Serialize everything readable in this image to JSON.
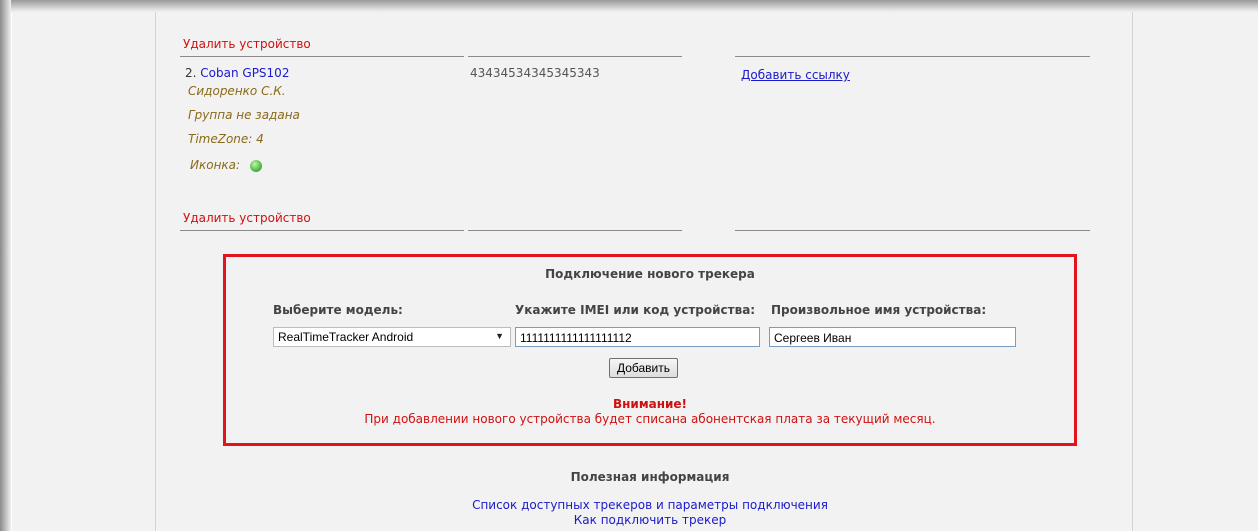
{
  "device_list": {
    "delete_label_top": "Удалить устройство",
    "device": {
      "number": "2.",
      "name": "Coban GPS102",
      "imei": "43434534345345343",
      "owner": "Сидоренко С.К.",
      "group": "Группа не задана",
      "timezone": "TimeZone: 4",
      "icon_label": "Иконка:",
      "add_link": "Добавить ссылку"
    },
    "delete_label_bottom": "Удалить устройство"
  },
  "new_tracker": {
    "title": "Подключение нового трекера",
    "model_label": "Выберите модель:",
    "imei_label": "Укажите IMEI или код устройства:",
    "name_label": "Произвольное имя устройства:",
    "model_value": "RealTimeTracker Android",
    "imei_value": "1111111111111111112",
    "name_value": "Сергеев Иван",
    "add_button": "Добавить",
    "warning_title": "Внимание!",
    "warning_text": "При добавлении нового устройства будет списана абонентская плата за текущий месяц."
  },
  "useful_info": {
    "title": "Полезная информация",
    "link1": "Список доступных трекеров и параметры подключения",
    "link2": "Как подключить трекер"
  },
  "colors": {
    "panel_border": "#e3141b",
    "warning": "#d01010",
    "link": "#1a1acc"
  }
}
